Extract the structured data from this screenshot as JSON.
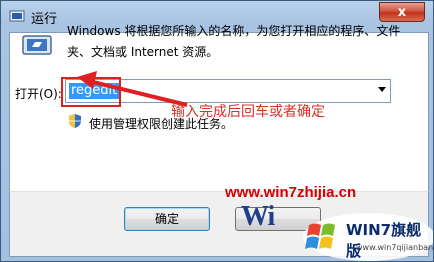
{
  "window": {
    "title": "运行",
    "close_label": "x"
  },
  "dialog": {
    "description": "Windows 将根据您所输入的名称，为您打开相应的程序、文件夹、文档或 Internet 资源。",
    "open_label": "打开(O):",
    "input_value": "regedit",
    "admin_text": "使用管理权限创建此任务。",
    "ok_label": "确定"
  },
  "annotation": {
    "text": "输入完成后回车或者确定"
  },
  "watermark": {
    "url": "www.win7zhijia.cn",
    "wi_text": "Wi",
    "brand_title": "WIN7旗舰版",
    "brand_url": "www.win7qijianban.com"
  },
  "colors": {
    "selection": "#3399ff",
    "annotation_red": "#d93025",
    "watermark_red": "#d40000"
  }
}
